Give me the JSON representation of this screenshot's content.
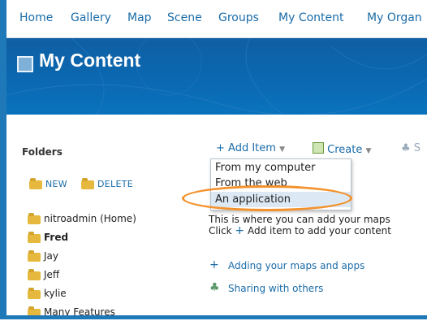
{
  "nav": {
    "items": [
      "Home",
      "Gallery",
      "Map",
      "Scene",
      "Groups",
      "My Content",
      "My Organ"
    ]
  },
  "banner": {
    "title": "My Content"
  },
  "folders": {
    "heading": "Folders",
    "new_label": "NEW",
    "delete_label": "DELETE",
    "items": [
      {
        "label": "nitroadmin (Home)",
        "bold": false
      },
      {
        "label": "Fred",
        "bold": true
      },
      {
        "label": "Jay",
        "bold": false
      },
      {
        "label": "Jeff",
        "bold": false
      },
      {
        "label": "kylie",
        "bold": false
      },
      {
        "label": "Many Features",
        "bold": false
      }
    ]
  },
  "toolbar": {
    "add_item": "Add Item",
    "create": "Create",
    "share_partial": "S"
  },
  "add_item_menu": {
    "items": [
      "From my computer",
      "From the web",
      "An application"
    ],
    "highlighted_index": 2
  },
  "main": {
    "line1": "This is where you can add your maps",
    "line2_pre": "Click",
    "line2_post": "Add item to add your content"
  },
  "help": {
    "adding": "Adding your maps and apps",
    "sharing": "Sharing with others"
  },
  "colors": {
    "accent": "#1a6ca8",
    "banner": "#0b69b3",
    "highlight_ring": "#f3922d"
  }
}
